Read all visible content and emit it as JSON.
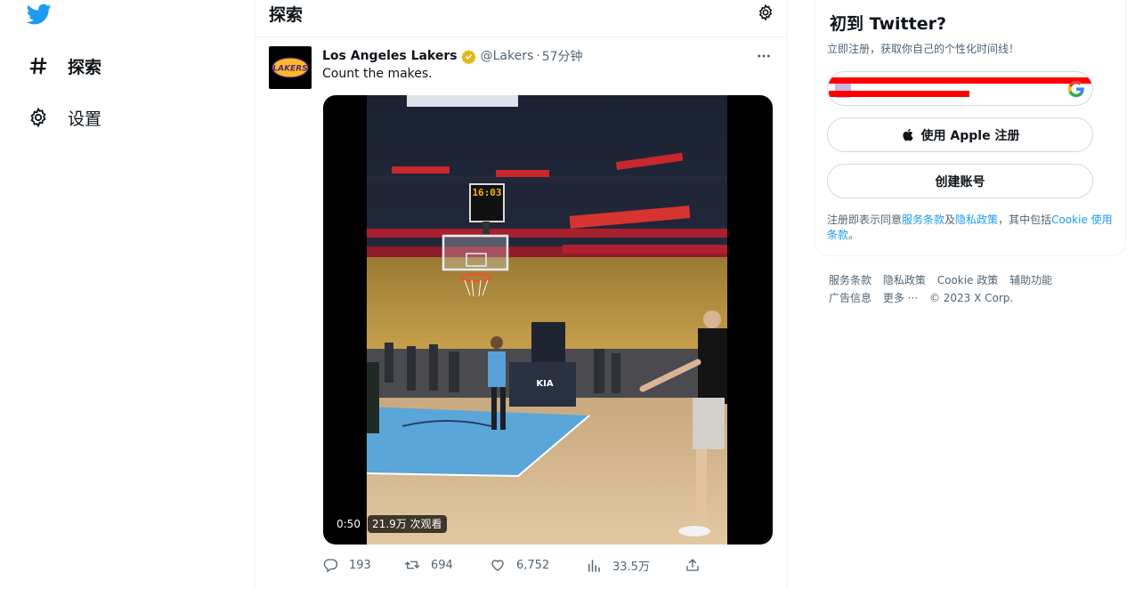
{
  "nav": {
    "items": [
      {
        "label": "探索",
        "icon": "hashtag-icon"
      },
      {
        "label": "设置",
        "icon": "gear-icon"
      }
    ]
  },
  "center": {
    "title": "探索"
  },
  "tweet": {
    "author_name": "Los Angeles Lakers",
    "handle": "@Lakers",
    "separator": "·",
    "time": "57分钟",
    "text": "Count the makes.",
    "avatar_text": "LAKERS",
    "media": {
      "duration": "0:50",
      "views": "21.9万 次观看",
      "scoreboard": "16:03"
    },
    "actions": {
      "replies": "193",
      "retweets": "694",
      "likes": "6,752",
      "views": "33.5万"
    }
  },
  "signup": {
    "title": "初到 Twitter?",
    "subtitle": "立即注册，获取你自己的个性化时间线！",
    "apple_label": "使用 Apple 注册",
    "create_label": "创建账号",
    "terms_prefix": "注册即表示同意",
    "terms_link": "服务条款",
    "terms_and": "及",
    "privacy_link": "隐私政策",
    "terms_mid": "，其中包括",
    "cookie_link": "Cookie 使用条款",
    "terms_end": "。"
  },
  "footer": {
    "links": [
      "服务条款",
      "隐私政策",
      "Cookie 政策",
      "辅助功能",
      "广告信息",
      "更多 ···"
    ],
    "copyright": "© 2023 X Corp."
  },
  "colors": {
    "brand_blue": "#1d9bf0",
    "text_primary": "#0f1419",
    "text_secondary": "#536471",
    "verified_gold": "#e2b719",
    "redaction": "#ff0000"
  }
}
